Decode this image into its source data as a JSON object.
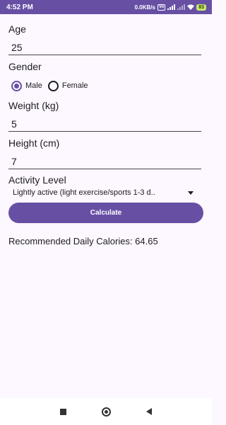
{
  "status_bar": {
    "time": "4:52 PM",
    "speed": "0.0KB/s",
    "vo_badge": "Vo",
    "battery": "83"
  },
  "form": {
    "age": {
      "label": "Age",
      "value": "25"
    },
    "gender": {
      "label": "Gender",
      "options": [
        "Male",
        "Female"
      ],
      "selected": "Male"
    },
    "weight": {
      "label": "Weight (kg)",
      "value": "5"
    },
    "height": {
      "label": "Height (cm)",
      "value": "7"
    },
    "activity": {
      "label": "Activity Level",
      "selected": "Lightly active (light exercise/sports 1-3 d.."
    },
    "calculate_label": "Calculate"
  },
  "result": {
    "text": "Recommended Daily Calories: 64.65"
  },
  "colors": {
    "primary": "#6750a4",
    "background": "#fdf7ff"
  },
  "nav_bar": {
    "recents_icon": "square-icon",
    "home_icon": "circle-icon",
    "back_icon": "triangle-back-icon"
  }
}
